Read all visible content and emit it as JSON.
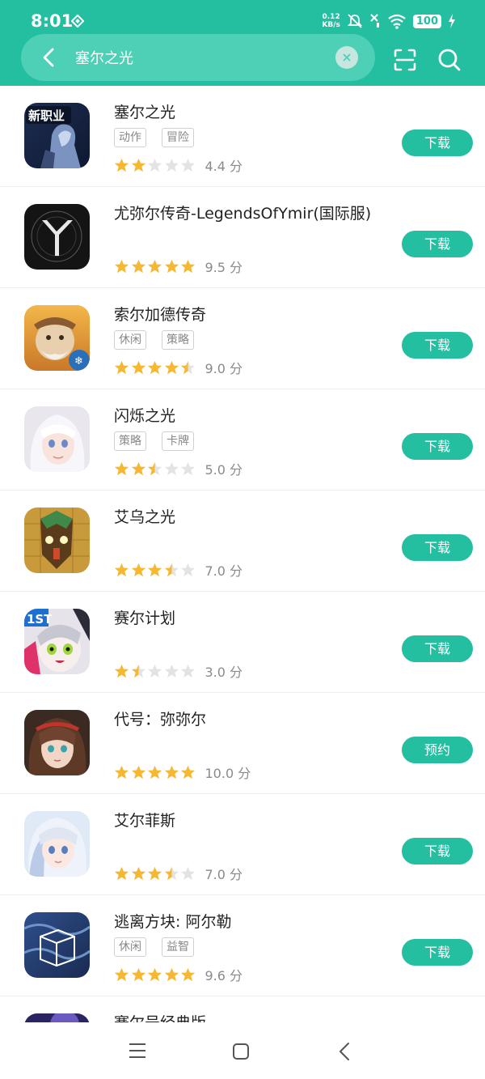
{
  "status": {
    "time": "8:01",
    "net_speed": "0.12",
    "net_unit": "KB/s",
    "battery": "100"
  },
  "search": {
    "query": "塞尔之光"
  },
  "colors": {
    "accent": "#23bfa0",
    "star": "#f6b731",
    "star_empty": "#e3e3e3"
  },
  "apps": [
    {
      "name": "塞尔之光",
      "tags": [
        "动作",
        "冒险"
      ],
      "rating": 2,
      "score": "4.4 分",
      "button": "下载",
      "icon_theme": "armored-knight",
      "icon_caption": "新职业"
    },
    {
      "name": "尤弥尔传奇-LegendsOfYmir(国际服)",
      "tags": [],
      "rating": 5,
      "score": "9.5 分",
      "button": "下载",
      "icon_theme": "ymir-logo"
    },
    {
      "name": "索尔加德传奇",
      "tags": [
        "休闲",
        "策略"
      ],
      "rating": 4.5,
      "score": "9.0 分",
      "button": "下载",
      "icon_theme": "dwarf-warrior"
    },
    {
      "name": "闪烁之光",
      "tags": [
        "策略",
        "卡牌"
      ],
      "rating": 2.5,
      "score": "5.0 分",
      "button": "下载",
      "icon_theme": "white-hair-girl"
    },
    {
      "name": "艾乌之光",
      "tags": [],
      "rating": 3.5,
      "score": "7.0 分",
      "button": "下载",
      "icon_theme": "tribal-mask"
    },
    {
      "name": "赛尔计划",
      "tags": [],
      "rating": 1.5,
      "score": "3.0 分",
      "button": "下载",
      "icon_theme": "anime-girl-green-eyes",
      "icon_caption": "1ST"
    },
    {
      "name": "代号：弥弥尔",
      "tags": [],
      "rating": 5,
      "score": "10.0 分",
      "button": "预约",
      "icon_theme": "brown-hair-girl"
    },
    {
      "name": "艾尔菲斯",
      "tags": [],
      "rating": 3.5,
      "score": "7.0 分",
      "button": "下载",
      "icon_theme": "silver-hair-girl"
    },
    {
      "name": "逃离方块: 阿尔勒",
      "tags": [
        "休闲",
        "益智"
      ],
      "rating": 5,
      "score": "9.6 分",
      "button": "下载",
      "icon_theme": "cube-starry-night"
    },
    {
      "name": "赛尔号经典版",
      "tags": [],
      "rating": 0,
      "score": "",
      "button": "",
      "icon_theme": "space-partial"
    }
  ]
}
